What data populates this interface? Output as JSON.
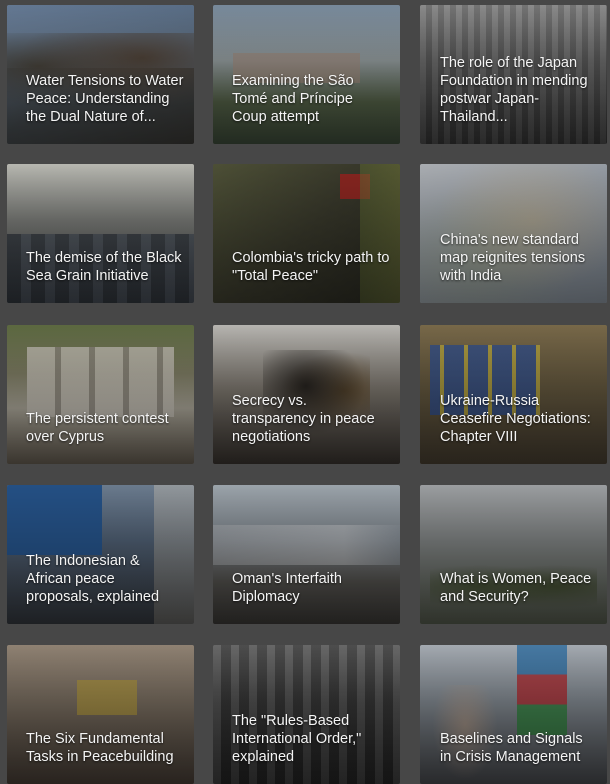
{
  "cards": [
    {
      "title": "Water Tensions to Water Peace: Understanding the Dual Nature of...",
      "thumb": "mountain-river-photo"
    },
    {
      "title": "Examining the São Tomé and Príncipe Coup attempt",
      "thumb": "government-building-photo"
    },
    {
      "title": "The role of the Japan Foundation in mending postwar Japan-Thailand...",
      "thumb": "historic-crowd-photo"
    },
    {
      "title": "The demise of the Black Sea Grain Initiative",
      "thumb": "conference-room-photo"
    },
    {
      "title": "Colombia's tricky path to \"Total Peace\"",
      "thumb": "armed-soldiers-photo"
    },
    {
      "title": "China's new standard map reignites tensions with India",
      "thumb": "map-photo"
    },
    {
      "title": "The persistent contest over Cyprus",
      "thumb": "barrels-wall-photo"
    },
    {
      "title": "Secrecy vs. transparency in peace negotiations",
      "thumb": "leaders-handshake-photo"
    },
    {
      "title": "Ukraine-Russia Ceasefire Negotiations: Chapter VIII",
      "thumb": "flags-podium-photo"
    },
    {
      "title": "The Indonesian & African peace proposals, explained",
      "thumb": "shangri-la-dialogue-photo"
    },
    {
      "title": "Oman's Interfaith Diplomacy",
      "thumb": "airport-arrival-photo"
    },
    {
      "title": "What is Women, Peace and Security?",
      "thumb": "women-soldiers-map-photo"
    },
    {
      "title": "The Six Fundamental Tasks in Peacebuilding",
      "thumb": "classroom-photo"
    },
    {
      "title": "The \"Rules-Based International Order,\" explained",
      "thumb": "tribunal-photo"
    },
    {
      "title": "Baselines and Signals in Crisis Management",
      "thumb": "leaders-flags-photo"
    }
  ]
}
